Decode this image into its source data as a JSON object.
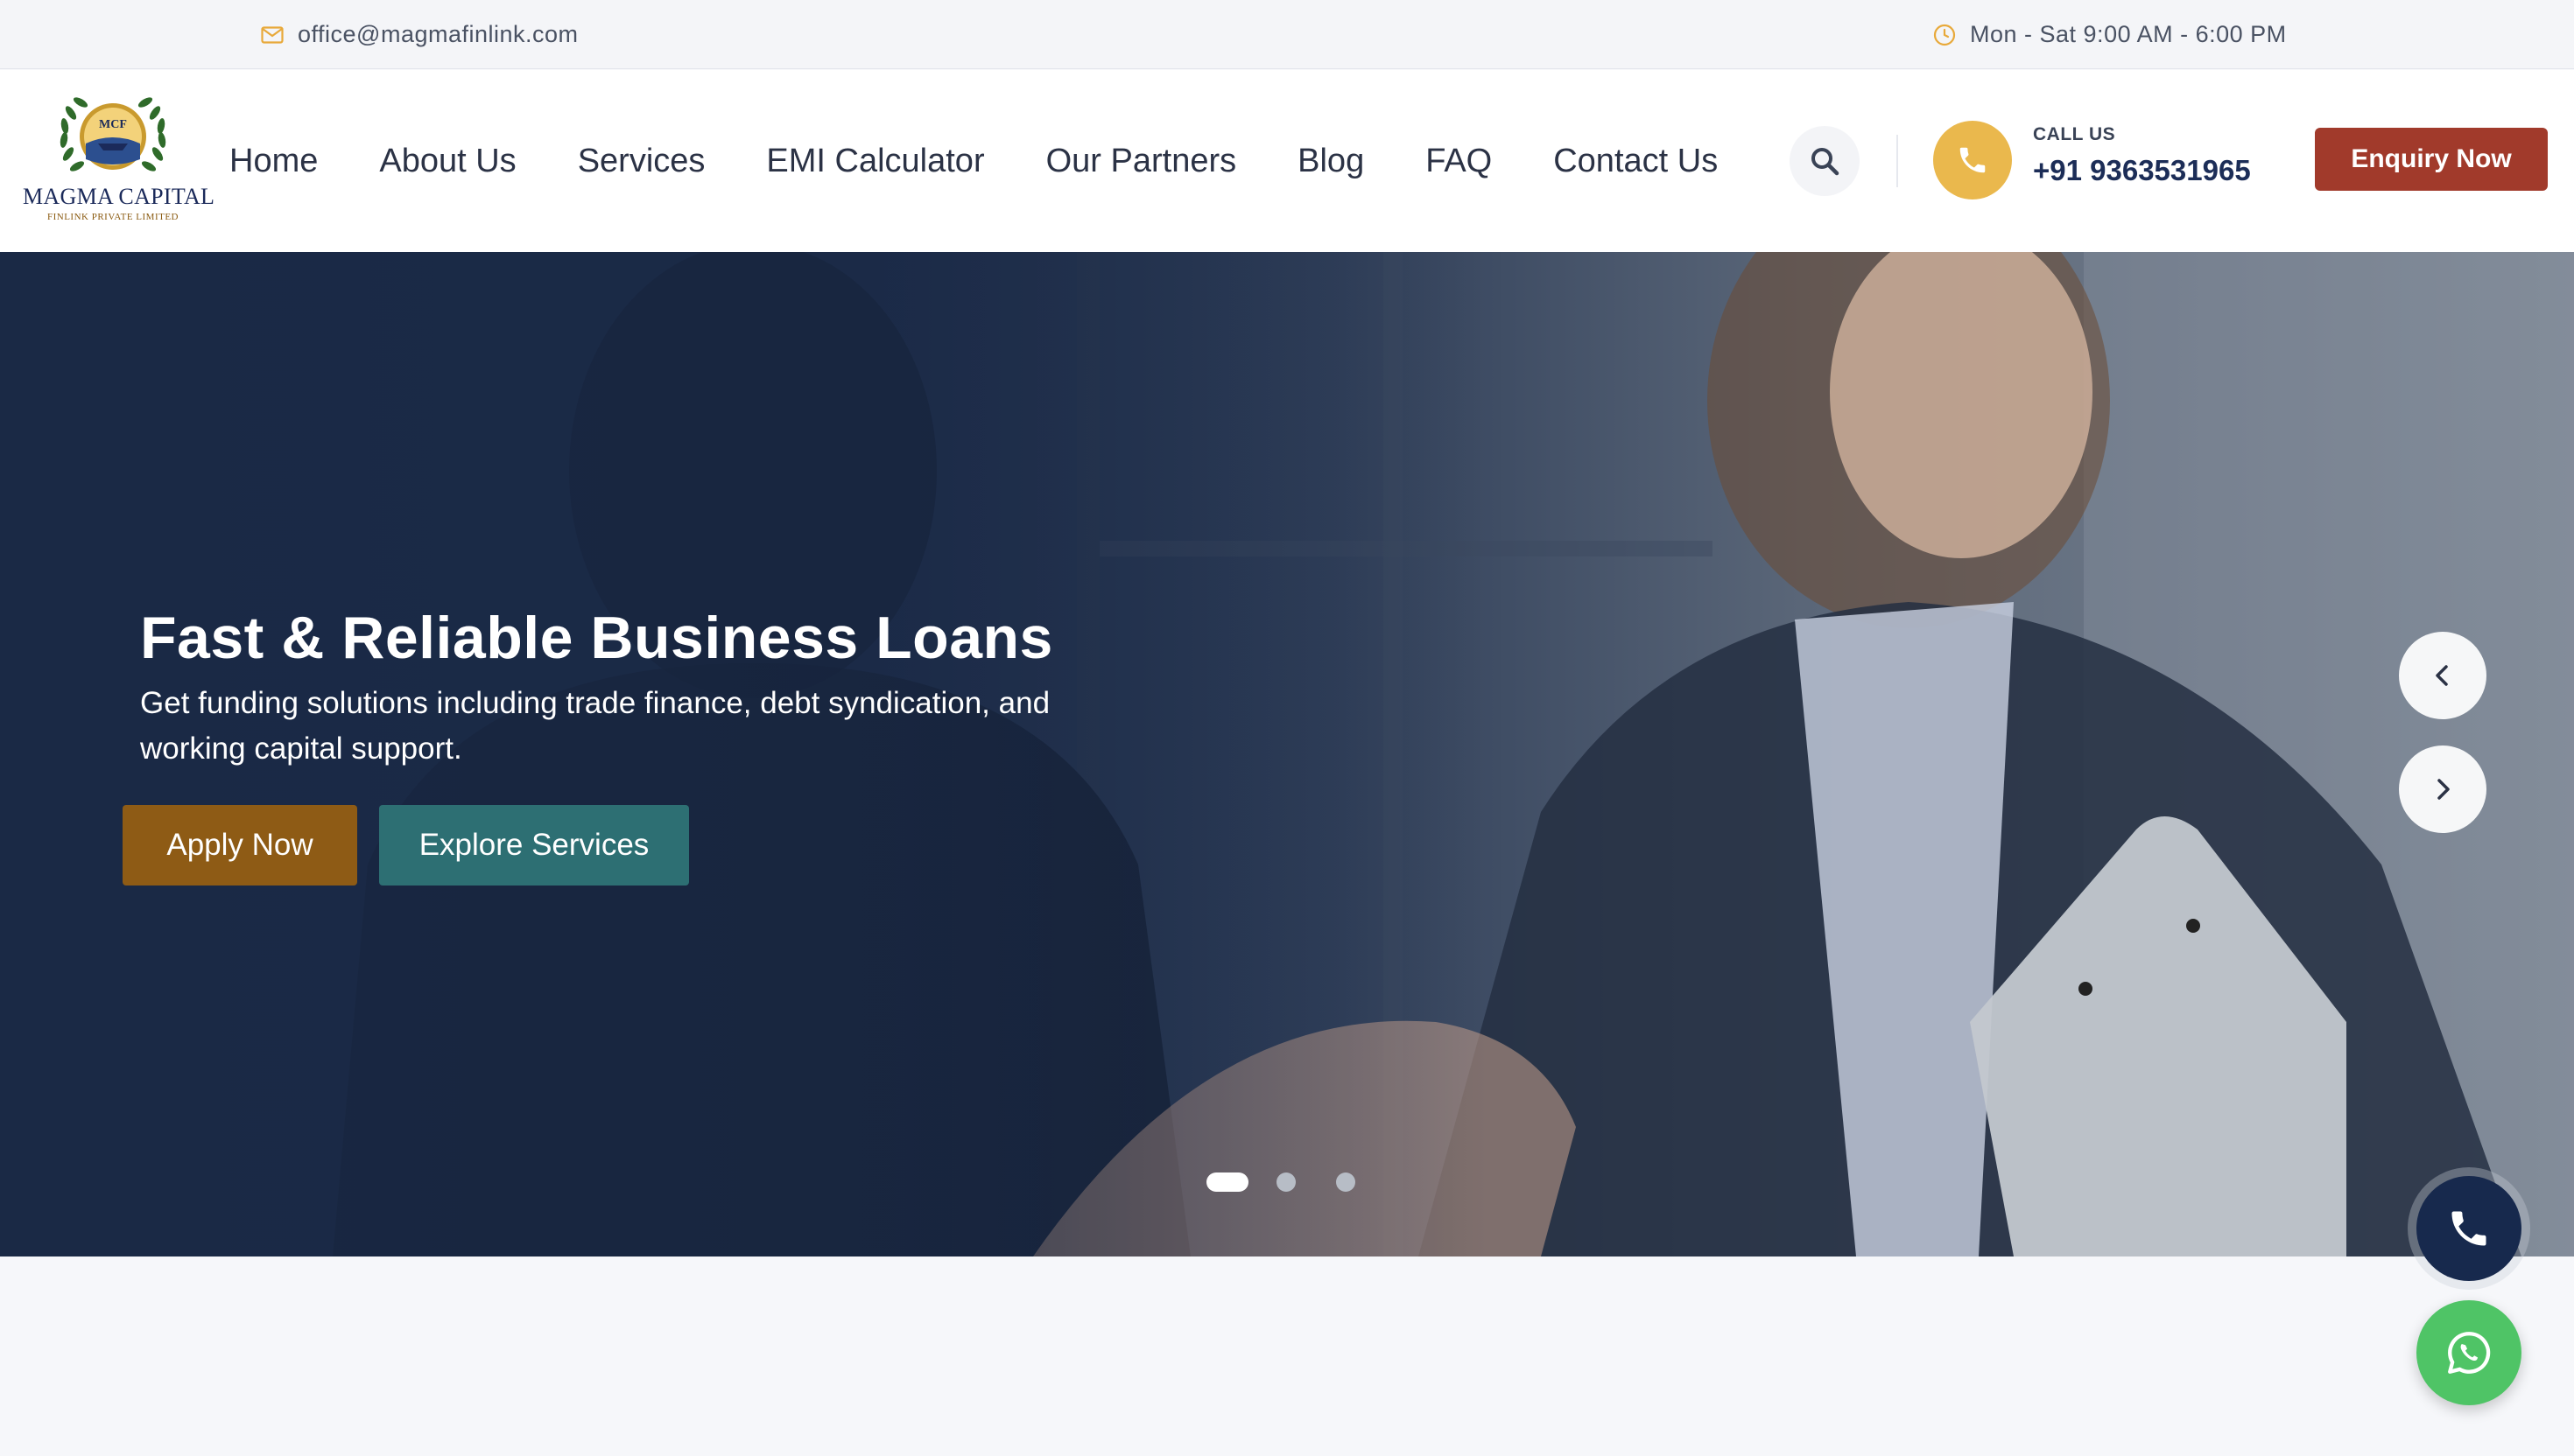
{
  "topbar": {
    "email": "office@magmafinlink.com",
    "hours": "Mon - Sat 9:00 AM - 6:00 PM"
  },
  "brand": {
    "emblem_text": "MCF",
    "name": "MAGMA CAPITAL",
    "tagline": "FINLINK PRIVATE LIMITED"
  },
  "nav": {
    "items": [
      "Home",
      "About Us",
      "Services",
      "EMI Calculator",
      "Our Partners",
      "Blog",
      "FAQ",
      "Contact Us"
    ]
  },
  "contact": {
    "label": "CALL US",
    "number": "+91 9363531965"
  },
  "header": {
    "enquiry_label": "Enquiry Now"
  },
  "hero": {
    "title": "Fast & Reliable Business Loans",
    "description": "Get funding solutions including trade finance, debt syndication, and working capital support.",
    "apply_label": "Apply Now",
    "explore_label": "Explore Services",
    "slides_total": 3,
    "active_slide": 1
  },
  "icons": {
    "email": "envelope-icon",
    "hours": "clock-icon",
    "search": "search-icon",
    "call": "phone-icon",
    "prev": "chevron-left-icon",
    "next": "chevron-right-icon",
    "whatsapp": "whatsapp-icon"
  },
  "colors": {
    "accent_gold": "#eab84d",
    "enquiry_red": "#a13a2b",
    "apply_brown": "#8e5b15",
    "explore_teal": "#2d6f73",
    "navy": "#17294d",
    "whatsapp_green": "#4fc466"
  }
}
